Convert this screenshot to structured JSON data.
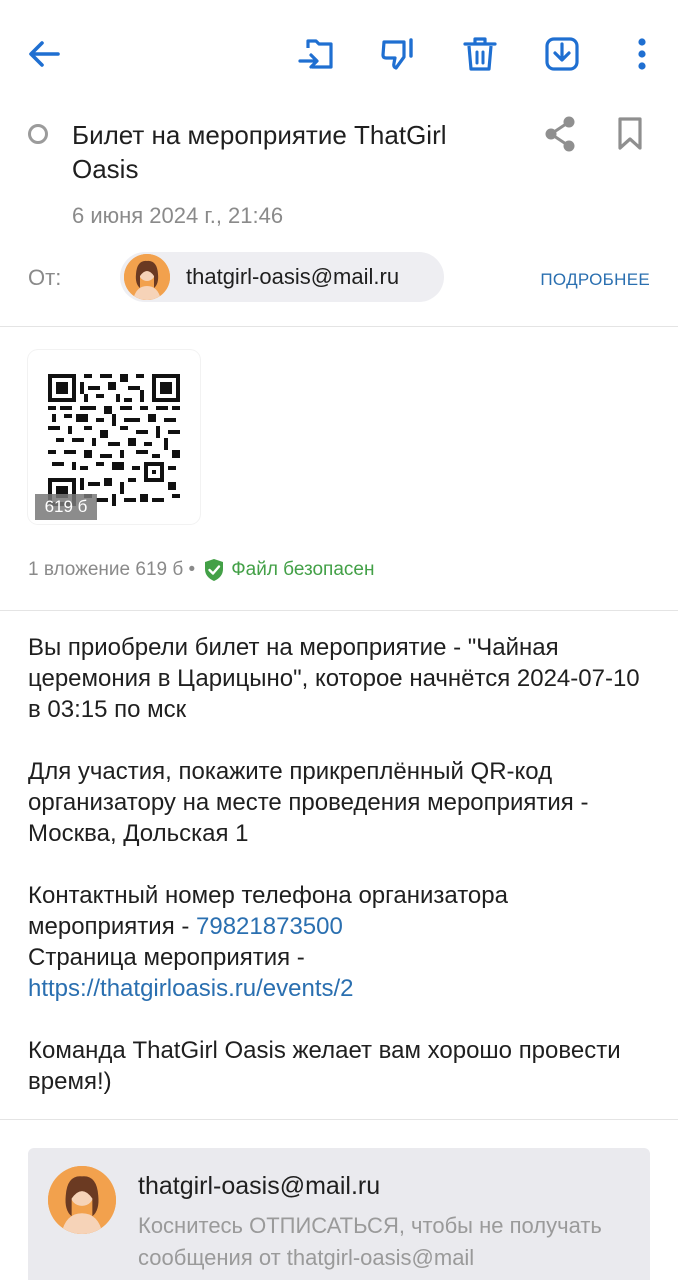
{
  "toolbar": {
    "back_icon": "arrow-left-icon",
    "move_icon": "move-to-folder-icon",
    "spam_icon": "thumbs-down-icon",
    "delete_icon": "trash-icon",
    "download_icon": "download-icon",
    "menu_icon": "more-vert-icon",
    "accent": "#1f6fd1"
  },
  "message": {
    "subject": "Билет на мероприятие ThatGirl Oasis",
    "date": "6 июня 2024 г., 21:46",
    "from_label": "От:",
    "sender_email": "thatgirl-oasis@mail.ru",
    "details_link": "ПОДРОБНЕЕ"
  },
  "attachment": {
    "badge_size": "619 б",
    "info": "1 вложение 619  б •",
    "safe_label": "Файл безопасен"
  },
  "body": {
    "p1": "Вы приобрели билет на мероприятие - \"Чайная церемония в Царицыно\", которое начнётся 2024-07-10 в 03:15 по мск",
    "p2": "Для участия, покажите прикреплённый QR-код организатору на месте проведения мероприятия - Москва, Дольская 1",
    "p3_prefix": "Контактный номер телефона организатора мероприятия - ",
    "phone": "79821873500",
    "p3_page_label": "Страница мероприятия -",
    "url": "https://thatgirloasis.ru/events/2",
    "p4": "Команда ThatGirl Oasis желает вам хорошо провести время!)"
  },
  "footer": {
    "email": "thatgirl-oasis@mail.ru",
    "note": "Коснитесь ОТПИСАТЬСЯ, чтобы не получать сообщения от thatgirl-oasis@mail"
  }
}
